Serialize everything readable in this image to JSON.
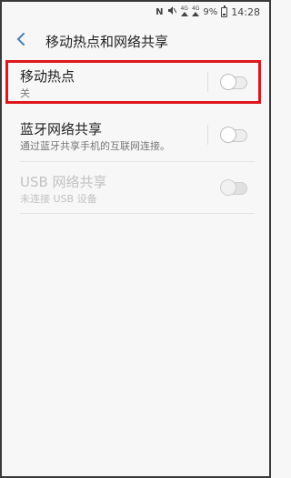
{
  "status_bar": {
    "nfc_icon": "N",
    "mute_icon": "mute-icon",
    "network_left": "4G",
    "network_right": "4G",
    "battery_percent": "9%",
    "time": "14:28"
  },
  "header": {
    "back_icon": "back-chevron-icon",
    "title": "移动热点和网络共享"
  },
  "settings": [
    {
      "title": "移动热点",
      "subtitle": "关",
      "enabled": true,
      "checked": false
    },
    {
      "title": "蓝牙网络共享",
      "subtitle": "通过蓝牙共享手机的互联网连接。",
      "enabled": true,
      "checked": false
    },
    {
      "title": "USB 网络共享",
      "subtitle": "未连接 USB 设备",
      "enabled": false,
      "checked": false
    }
  ],
  "colors": {
    "highlight": "#e0161e",
    "accent_back": "#4a7fb5"
  }
}
